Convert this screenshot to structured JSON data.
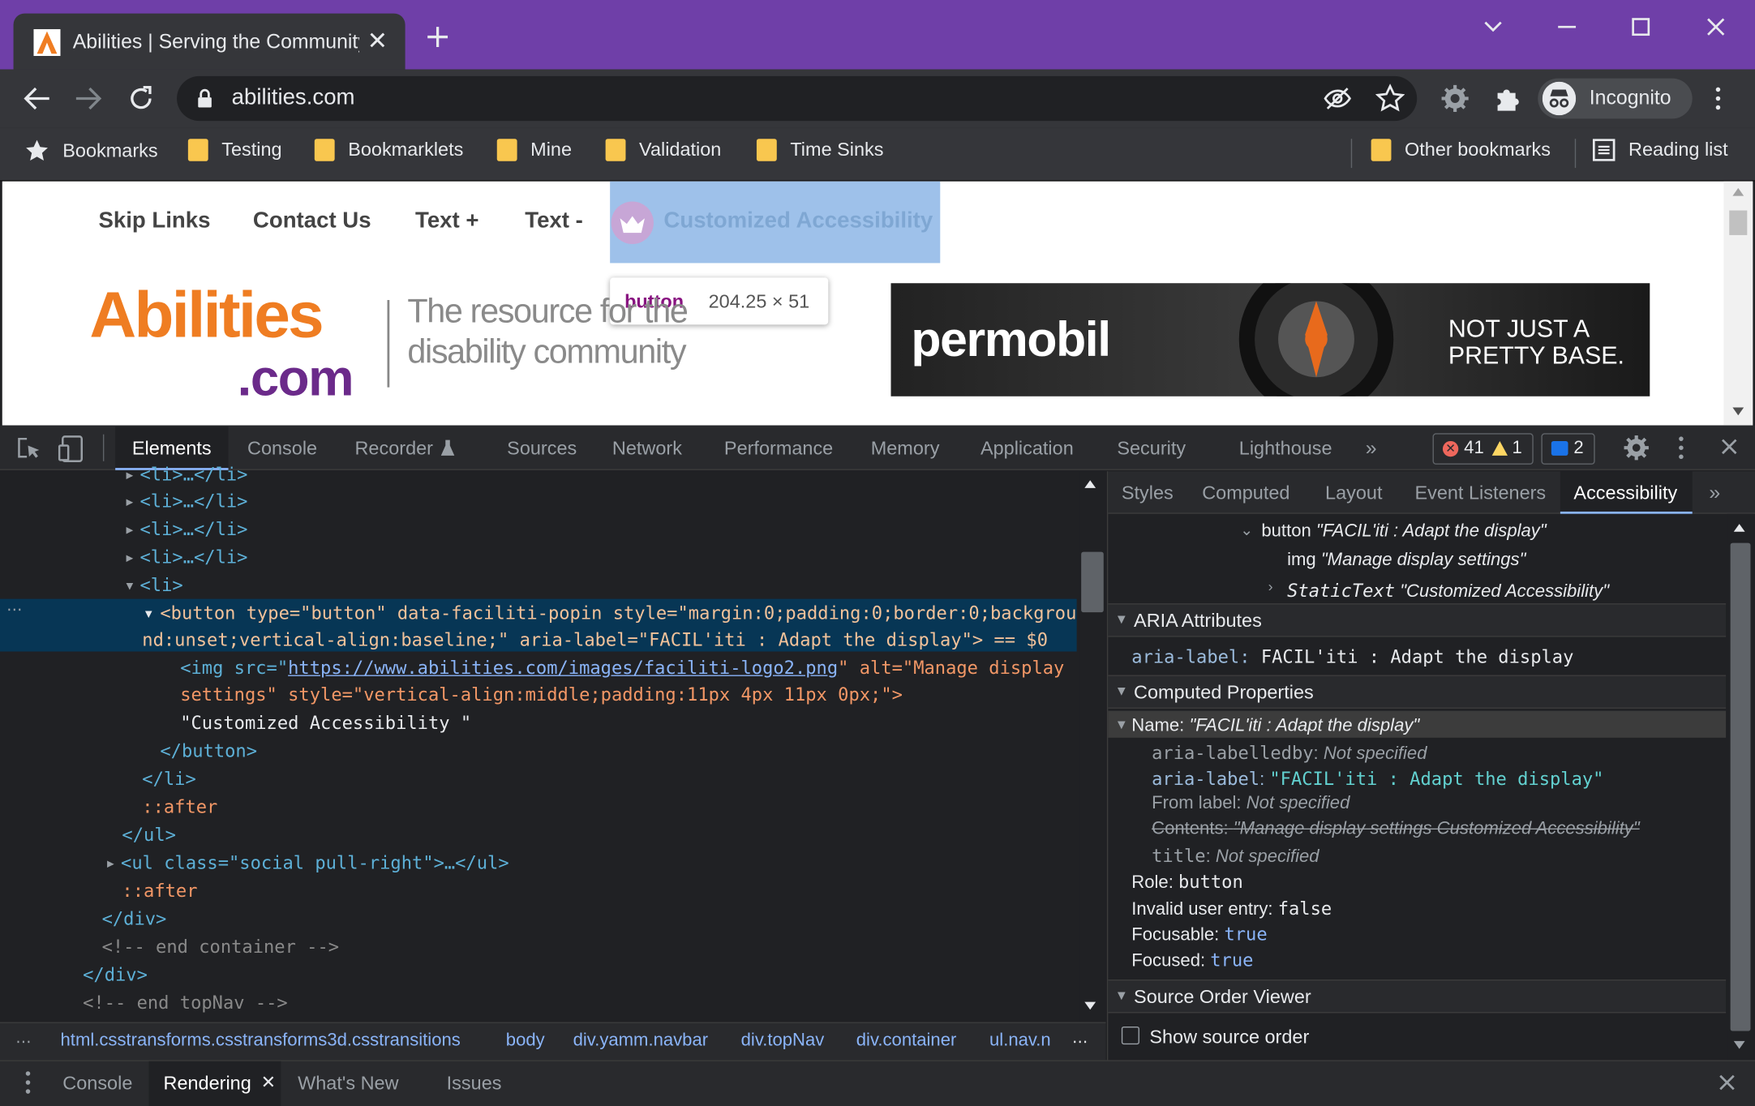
{
  "browser": {
    "tab_title": "Abilities | Serving the Community",
    "url": "abilities.com",
    "incognito_label": "Incognito",
    "bookmarks": [
      "Bookmarks",
      "Testing",
      "Bookmarklets",
      "Mine",
      "Validation",
      "Time Sinks"
    ],
    "other_bookmarks": "Other bookmarks",
    "reading_list": "Reading list"
  },
  "page": {
    "nav": [
      "Skip Links",
      "Contact Us",
      "Text +",
      "Text -",
      "Customized Accessibility"
    ],
    "tooltip_tag": "button",
    "tooltip_size": "204.25 × 51",
    "logo_top": "Abilities",
    "logo_bottom": ".com",
    "tagline_1": "The resource for the",
    "tagline_2": "disability community",
    "ad_brand": "permobil",
    "ad_text_1": "NOT JUST A",
    "ad_text_2": "PRETTY BASE."
  },
  "devtools": {
    "tabs": [
      "Elements",
      "Console",
      "Recorder",
      "Sources",
      "Network",
      "Performance",
      "Memory",
      "Application",
      "Security",
      "Lighthouse"
    ],
    "errors": "41",
    "warnings": "1",
    "messages": "2",
    "dom": {
      "li_collapsed": "<li>…</li>",
      "li_open": "<li>",
      "sel_1a": "<button type=\"button\" data-faciliti-popin style=\"margin:0;padding:0;border:0;backgrou",
      "sel_1b": "nd:unset;vertical-align:baseline;\" aria-label=\"FACIL'iti : Adapt the display\"> == $0",
      "img_1_pre": "<img src=\"",
      "img_1_link": "https://www.abilities.com/images/faciliti-logo2.png",
      "img_1_post": "\" alt=\"Manage display",
      "img_2": "settings\" style=\"vertical-align:middle;padding:11px 4px 11px 0px;\">",
      "text_node": "\"Customized Accessibility \"",
      "close_button": "</button>",
      "close_li": "</li>",
      "after": "::after",
      "close_ul": "</ul>",
      "ul_social": "<ul class=\"social pull-right\">…</ul>",
      "close_div": "</div>",
      "comment_container": "<!-- end container -->",
      "comment_topnav": "<!-- end topNav -->"
    },
    "breadcrumbs": [
      "html.csstransforms.csstransforms3d.csstransitions",
      "body",
      "div.yamm.navbar",
      "div.topNav",
      "div.container",
      "ul.nav.n"
    ],
    "side_tabs": [
      "Styles",
      "Computed",
      "Layout",
      "Event Listeners",
      "Accessibility"
    ],
    "tree": {
      "button": "button",
      "button_name": "\"FACIL'iti : Adapt the display\"",
      "img": "img",
      "img_name": "\"Manage display settings\"",
      "static": "StaticText",
      "static_name": "\"Customized Accessibility\""
    },
    "aria_header": "ARIA Attributes",
    "aria_key": "aria-label",
    "aria_val": "FACIL'iti : Adapt the display",
    "computed_header": "Computed Properties",
    "name_key": "Name:",
    "name_val": "\"FACIL'iti : Adapt the display\"",
    "labelledby_key": "aria-labelledby",
    "labelledby_val": "Not specified",
    "arialabel_key": "aria-label",
    "arialabel_val": "\"FACIL'iti : Adapt the display\"",
    "fromlabel_key": "From label:",
    "fromlabel_val": "Not specified",
    "contents_key": "Contents:",
    "contents_val": "\"Manage display settings Customized Accessibility\"",
    "title_key": "title",
    "title_val": "Not specified",
    "role_key": "Role:",
    "role_val": "button",
    "invalid_key": "Invalid user entry:",
    "invalid_val": "false",
    "focusable_key": "Focusable:",
    "focusable_val": "true",
    "focused_key": "Focused:",
    "focused_val": "true",
    "source_header": "Source Order Viewer",
    "show_source": "Show source order",
    "drawer_tabs": [
      "Console",
      "Rendering",
      "What's New",
      "Issues"
    ]
  },
  "colors": {
    "titlebar": "#6f3fa8",
    "selection": "#073655",
    "highlight": "#9ec1ea",
    "accent": "#8ab4f8"
  }
}
